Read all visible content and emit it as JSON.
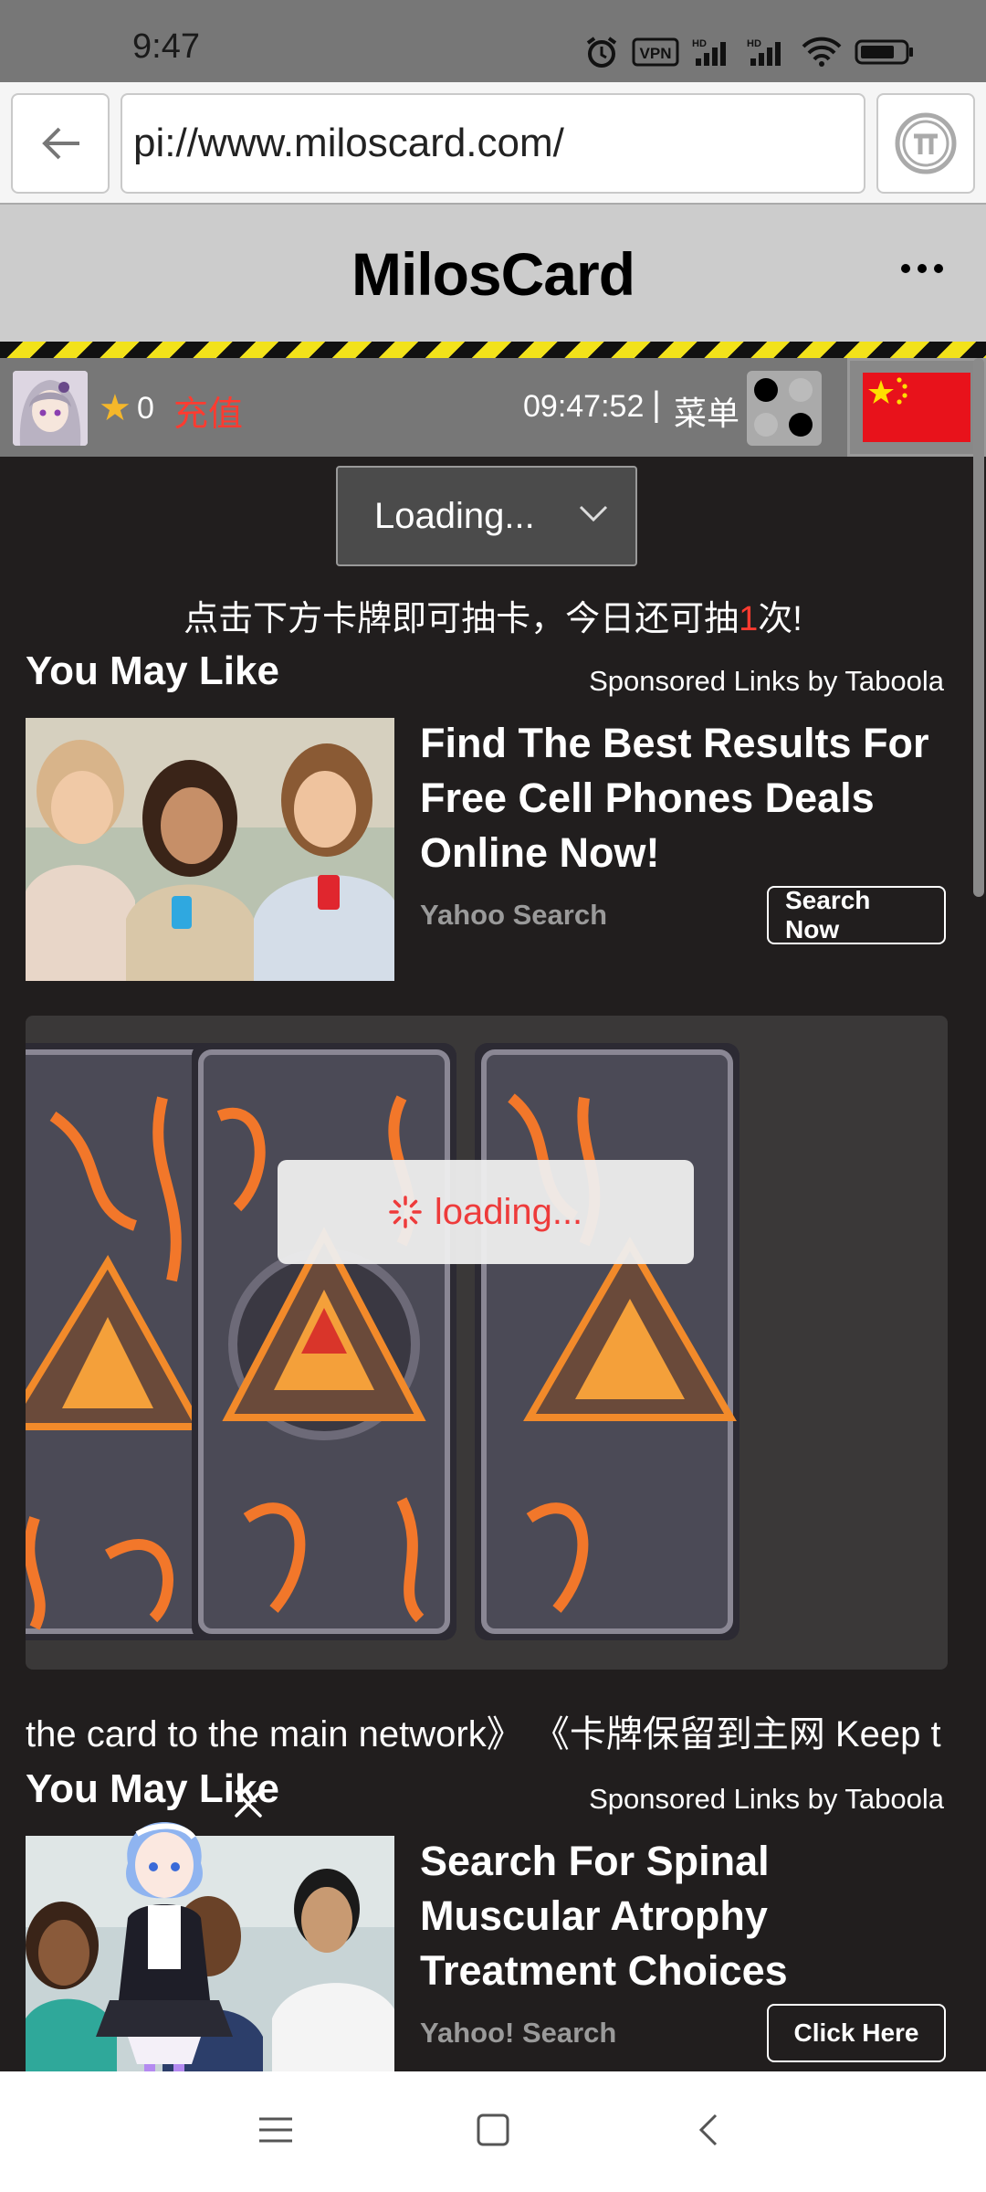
{
  "status_bar": {
    "time": "9:47",
    "icons": [
      "alarm-icon",
      "vpn-icon",
      "hd-signal-icon",
      "hd-signal-icon",
      "wifi-icon",
      "battery-icon"
    ]
  },
  "url_bar": {
    "url": "pi://www.miloscard.com/"
  },
  "header": {
    "title": "MilosCard"
  },
  "toolbar": {
    "stars": "0",
    "recharge_label": "充值",
    "clock": "09:47:52",
    "separator": "|",
    "menu_label": "菜单"
  },
  "selector": {
    "value": "Loading..."
  },
  "notice": {
    "before": "点击下方卡牌即可抽卡，今日还可抽",
    "count": "1",
    "after": "次!"
  },
  "ad1": {
    "section_title": "You May Like",
    "sponsored": "Sponsored Links by Taboola",
    "headline": "Find The Best Results For Free Cell Phones Deals Online Now!",
    "source": "Yahoo Search",
    "button": "Search Now"
  },
  "cards": {
    "loading_text": "loading..."
  },
  "marquee": {
    "text": "the card to the main network》  《卡牌保留到主网 Keep t"
  },
  "ad2": {
    "section_title": "You May Like",
    "sponsored": "Sponsored Links by Taboola",
    "headline": "Search For Spinal Muscular Atrophy Treatment Choices",
    "source": "Yahoo! Search",
    "button": "Click Here"
  },
  "colors": {
    "accent_red": "#ff3b30",
    "star": "#f5b72a",
    "background": "#211e1e"
  }
}
